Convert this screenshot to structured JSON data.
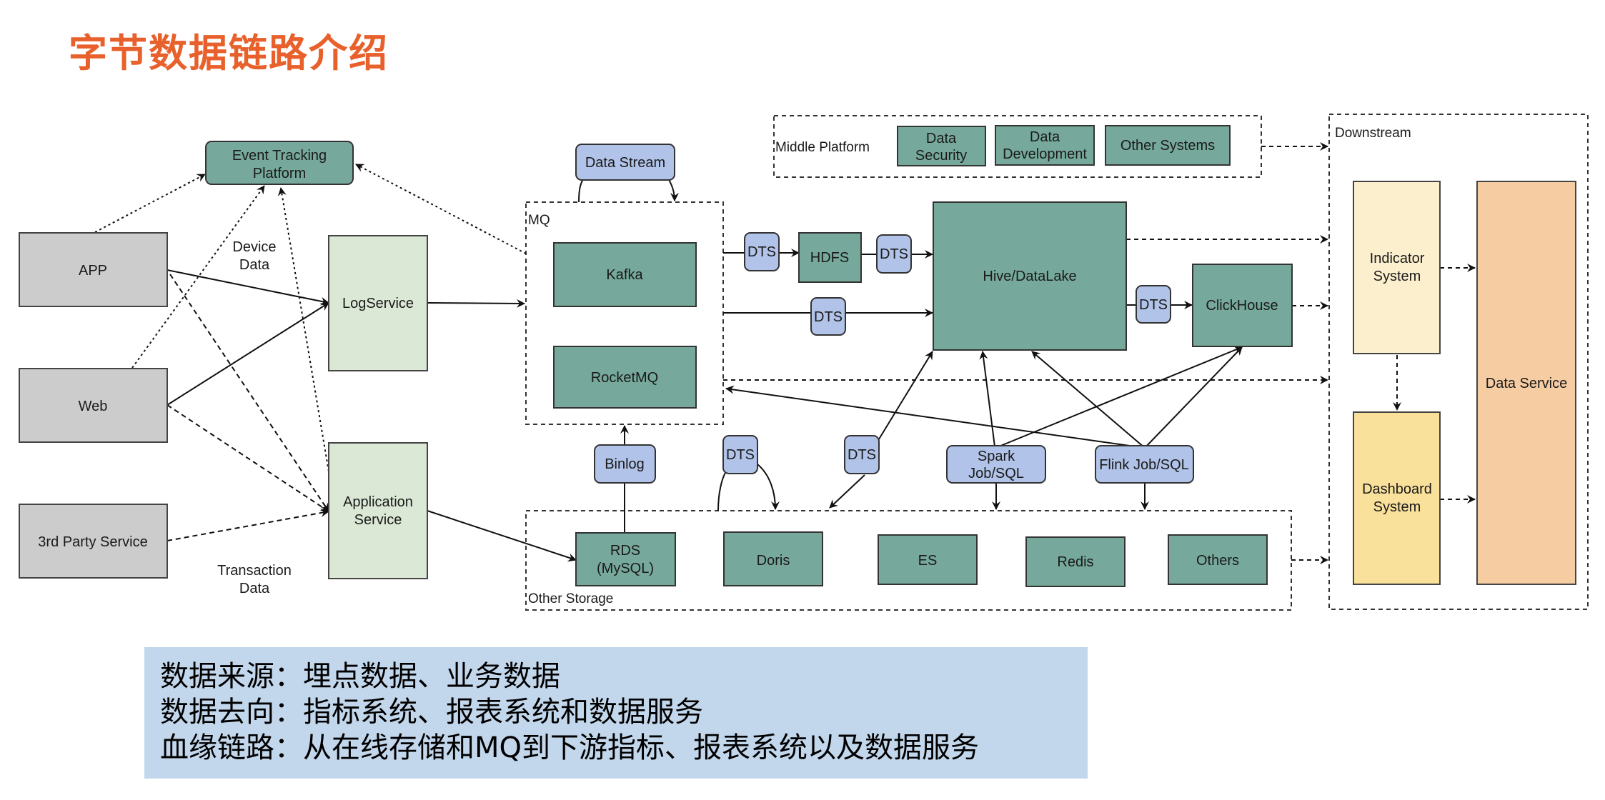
{
  "title": "字节数据链路介绍",
  "colors": {
    "title": "#e8612c",
    "teal_node": "#76a99b",
    "blue_node": "#b1c3e8",
    "gray_node": "#cccccc",
    "light_green_node": "#dbe8d5",
    "indicator_node": "#fcefcd",
    "dashboard_node": "#f9e09b",
    "data_service_node": "#f6cda3",
    "summary_bg": "#c3d7ec"
  },
  "sources": {
    "app": "APP",
    "web": "Web",
    "third_party": "3rd Party Service"
  },
  "event_tracking": [
    "Event Tracking",
    "Platform"
  ],
  "annotations": {
    "device_data": [
      "Device",
      "Data"
    ],
    "transaction_data": [
      "Transaction",
      "Data"
    ]
  },
  "services": {
    "log_service": "LogService",
    "application_service": [
      "Application",
      "Service"
    ]
  },
  "data_stream": "Data Stream",
  "mq": {
    "label": "MQ",
    "kafka": "Kafka",
    "rocketmq": "RocketMQ"
  },
  "middle_platform": {
    "label": "Middle Platform",
    "items": [
      [
        "Data",
        "Security"
      ],
      [
        "Data",
        "Development"
      ],
      [
        "Other Systems"
      ]
    ]
  },
  "dts_label": "DTS",
  "hdfs": "HDFS",
  "hive": "Hive/DataLake",
  "clickhouse": "ClickHouse",
  "binlog": "Binlog",
  "spark": [
    "Spark",
    "Job/SQL"
  ],
  "flink": "Flink Job/SQL",
  "other_storage": {
    "label": "Other Storage",
    "rds": [
      "RDS",
      "(MySQL)"
    ],
    "doris": "Doris",
    "es": "ES",
    "redis": "Redis",
    "others": "Others"
  },
  "downstream": {
    "label": "Downstream",
    "indicator": [
      "Indicator",
      "System"
    ],
    "dashboard": [
      "Dashboard",
      "System"
    ],
    "data_service": "Data Service"
  },
  "summary": [
    "数据来源：埋点数据、业务数据",
    "数据去向：指标系统、报表系统和数据服务",
    "血缘链路：从在线存储和MQ到下游指标、报表系统以及数据服务"
  ]
}
